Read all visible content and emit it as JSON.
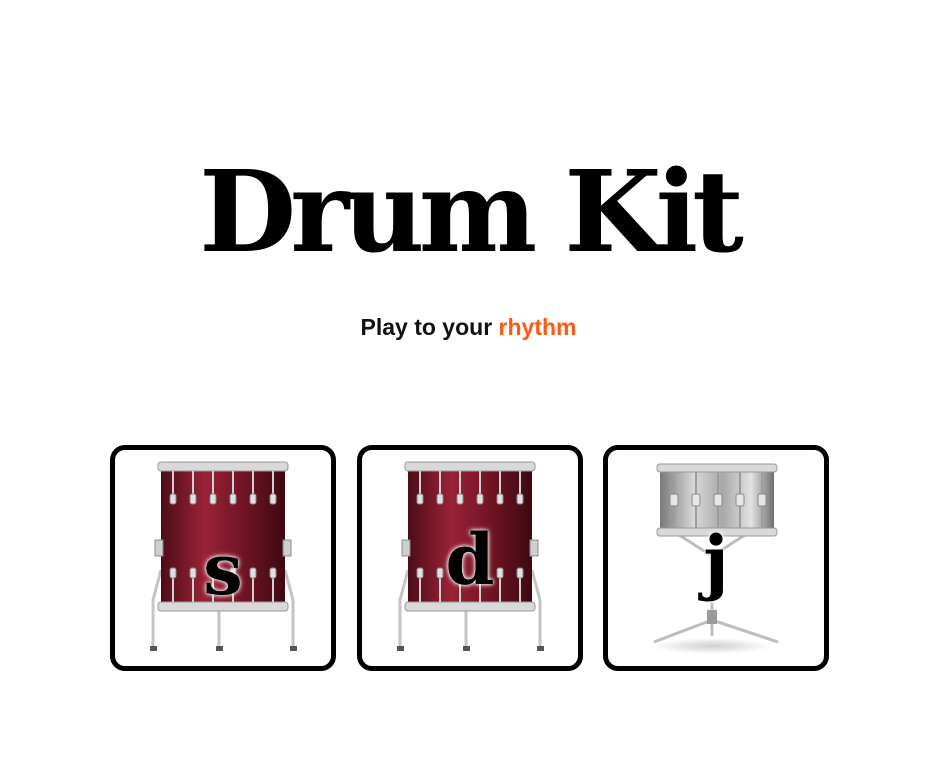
{
  "header": {
    "title": "Drum Kit",
    "subtitle_prefix": "Play to your",
    "subtitle_accent": "rhythm"
  },
  "colors": {
    "accent": "#ff5a14",
    "tom_body": "#8a1a2e",
    "snare_body": "#b0b0b0",
    "border": "#000000"
  },
  "drums": [
    {
      "key": "s",
      "icon": "floor-tom-icon"
    },
    {
      "key": "d",
      "icon": "floor-tom-icon"
    },
    {
      "key": "j",
      "icon": "snare-drum-icon"
    }
  ]
}
